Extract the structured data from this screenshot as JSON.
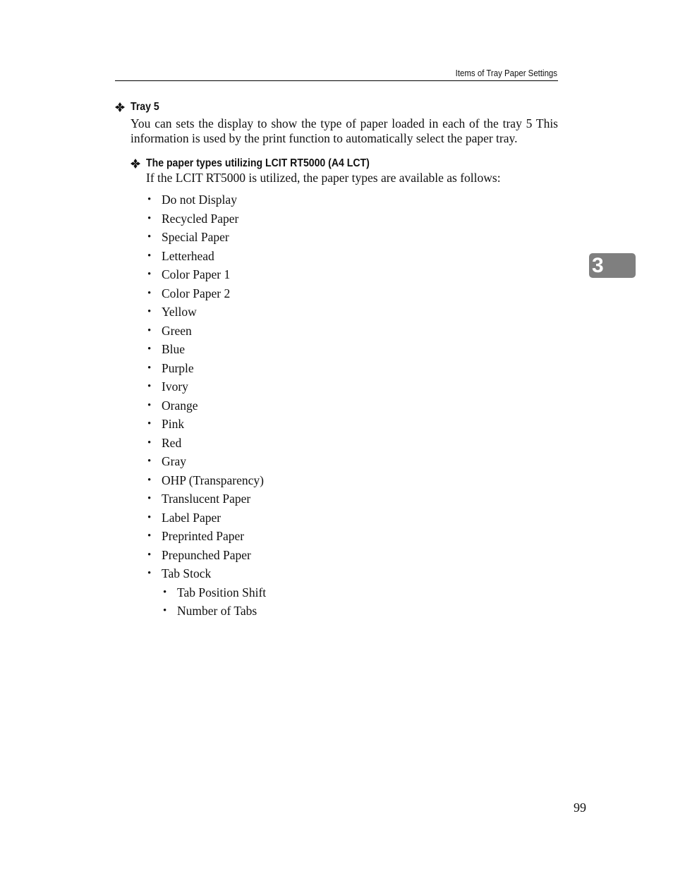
{
  "running_head": "Items of Tray Paper Settings",
  "section": {
    "heading": "Tray 5",
    "paragraph": "You can sets the display to show the type of paper loaded in each of the tray 5 This information is used by the print function to automatically select the paper tray.",
    "subsection": {
      "heading": "The paper types utilizing LCIT RT5000 (A4 LCT)",
      "paragraph": "If the LCIT RT5000 is utilized, the paper types are available as follows:",
      "items": [
        "Do not Display",
        "Recycled Paper",
        "Special Paper",
        "Letterhead",
        "Color Paper 1",
        "Color Paper 2",
        "Yellow",
        "Green",
        "Blue",
        "Purple",
        "Ivory",
        "Orange",
        "Pink",
        "Red",
        "Gray",
        "OHP (Transparency)",
        "Translucent Paper",
        "Label Paper",
        "Preprinted Paper",
        "Prepunched Paper",
        "Tab Stock"
      ],
      "tab_stock_subitems": [
        "Tab Position Shift",
        "Number of Tabs"
      ]
    }
  },
  "chapter_tab": "3",
  "page_number": "99",
  "colors": {
    "chapter_tab_bg": "#7f7f7f",
    "text": "#111111"
  }
}
